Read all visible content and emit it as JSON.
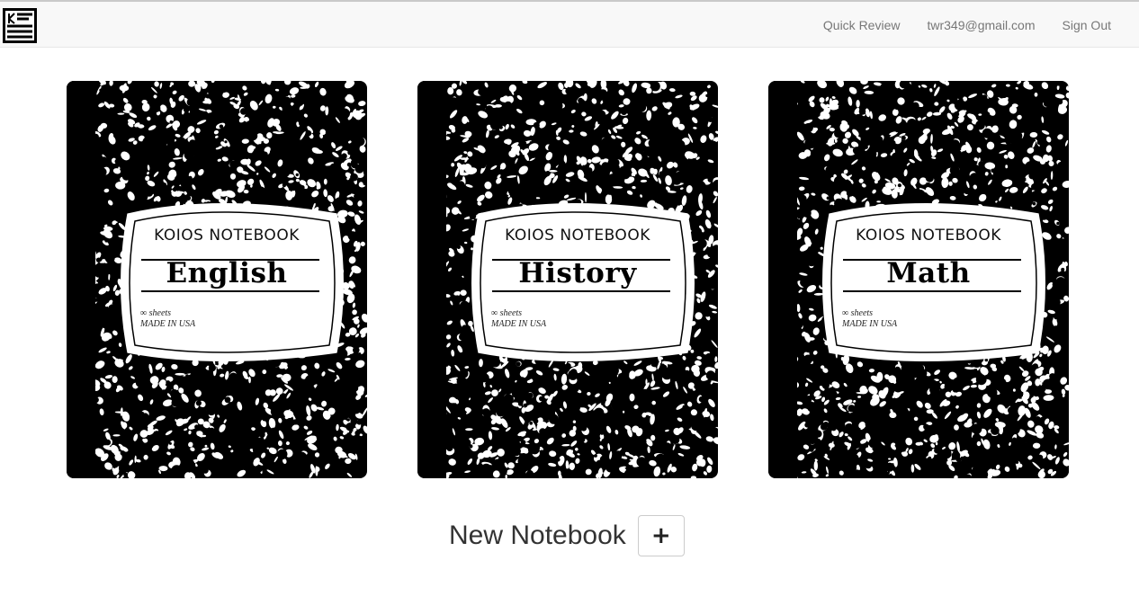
{
  "navbar": {
    "logo_icon": "koios-logo-icon",
    "links": [
      {
        "label": "Quick Review"
      },
      {
        "label": "twr349@gmail.com"
      },
      {
        "label": "Sign Out"
      }
    ]
  },
  "notebooks": [
    {
      "brand": "KOIOS NOTEBOOK",
      "subject": "English",
      "sheets": "∞ sheets",
      "made": "MADE IN USA"
    },
    {
      "brand": "KOIOS NOTEBOOK",
      "subject": "History",
      "sheets": "∞ sheets",
      "made": "MADE IN USA"
    },
    {
      "brand": "KOIOS NOTEBOOK",
      "subject": "Math",
      "sheets": "∞ sheets",
      "made": "MADE IN USA"
    }
  ],
  "new_notebook": {
    "label": "New Notebook",
    "button_icon": "plus-icon",
    "button_label": "+"
  }
}
